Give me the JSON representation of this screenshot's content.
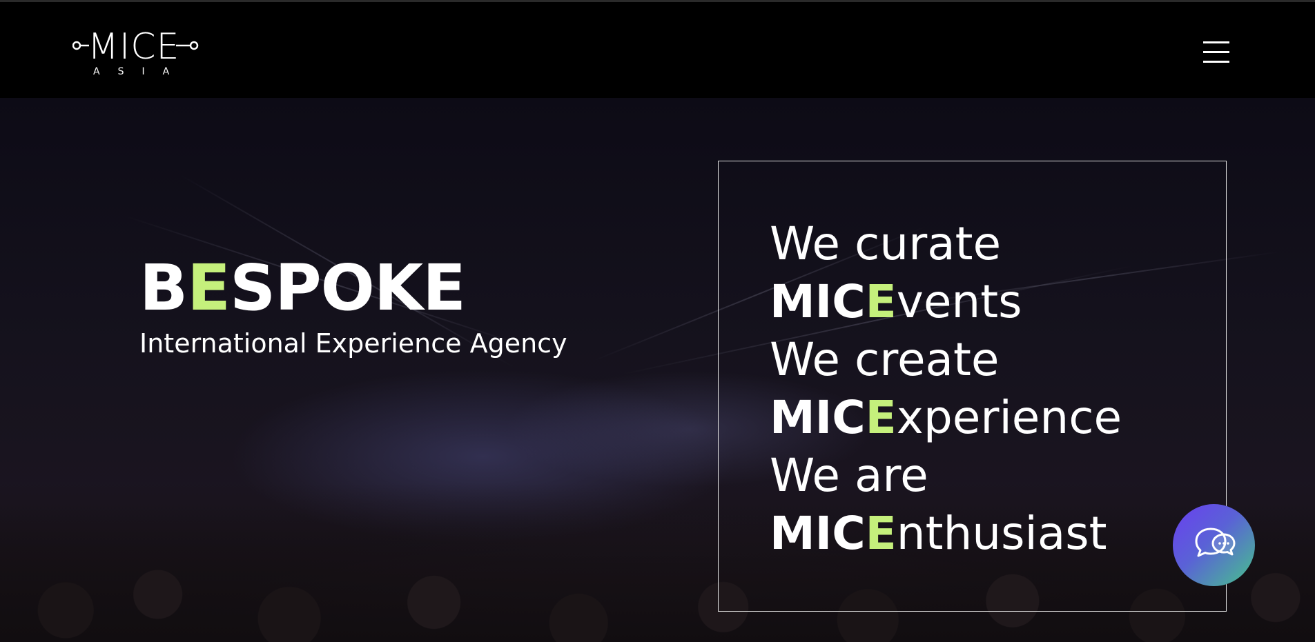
{
  "header": {
    "logo": {
      "main": "MICE",
      "sub": "ASIA"
    },
    "menu_icon": "hamburger-menu-icon"
  },
  "hero": {
    "title": {
      "before": "B",
      "accent": "E",
      "after": "SPOKE"
    },
    "tagline": "International Experience Agency",
    "statement": [
      {
        "prefix": "We curate",
        "accent": "",
        "suffix": ""
      },
      {
        "prefix": "MIC",
        "accent": "E",
        "suffix": "vents"
      },
      {
        "prefix": "We create",
        "accent": "",
        "suffix": ""
      },
      {
        "prefix": "MIC",
        "accent": "E",
        "suffix": "xperience"
      },
      {
        "prefix": "We are",
        "accent": "",
        "suffix": ""
      },
      {
        "prefix": "MIC",
        "accent": "E",
        "suffix": "nthusiast"
      }
    ]
  },
  "chat": {
    "icon": "chat-bubbles-icon"
  },
  "colors": {
    "accent": "#c5f07c",
    "header_bg": "#000000",
    "hero_bg": "#15121d",
    "chat_gradient_start": "#6a3ff0",
    "chat_gradient_end": "#46c48a"
  }
}
